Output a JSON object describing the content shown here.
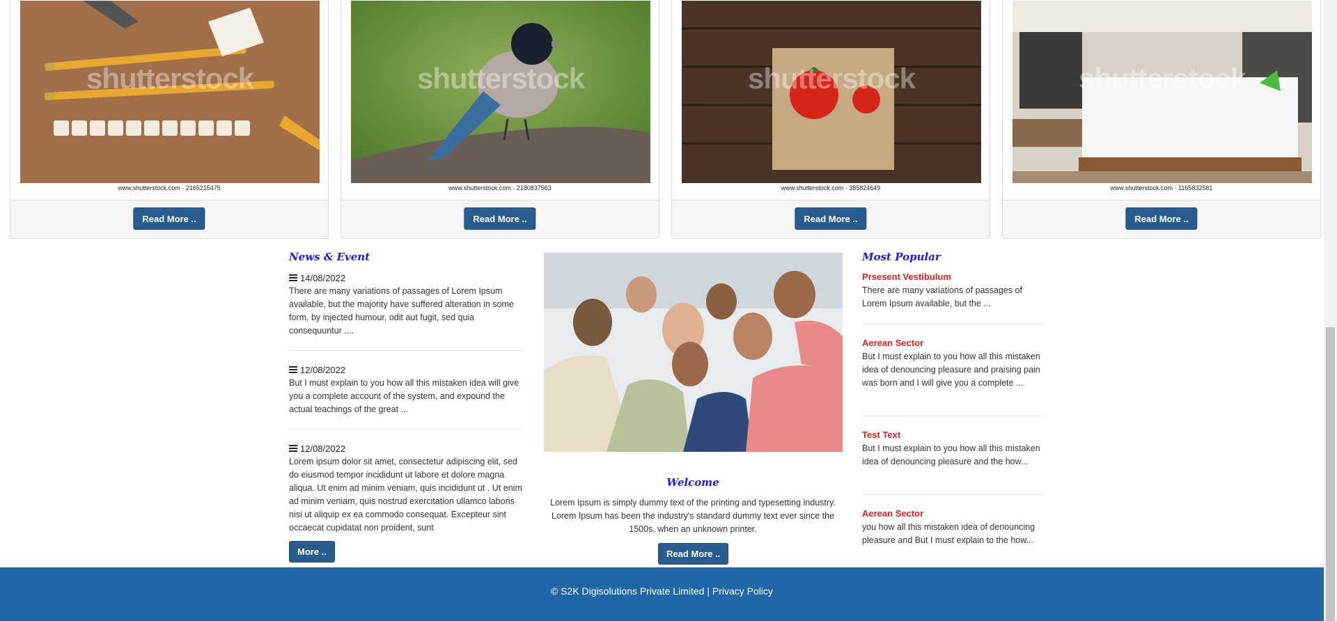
{
  "cards": [
    {
      "image": "pencils-shrinkflation-photo",
      "watermark": "shutterstock",
      "credit": "www.shutterstock.com · 2165215475",
      "button": "Read More .."
    },
    {
      "image": "blue-bird-photo",
      "watermark": "shutterstock",
      "credit": "www.shutterstock.com · 2180837563",
      "button": "Read More .."
    },
    {
      "image": "tomatoes-photo",
      "watermark": "shutterstock",
      "credit": "www.shutterstock.com · 385824649",
      "button": "Read More .."
    },
    {
      "image": "hotel-bedroom-photo",
      "watermark": "shutterstock",
      "credit": "www.shutterstock.com · 1165832581",
      "button": "Read More .."
    }
  ],
  "news": {
    "heading": "News & Event",
    "items": [
      {
        "date": "14/08/2022",
        "text": "There are many variations of passages of Lorem Ipsum available, but the majority have suffered alteration in some form, by injected humour, odit aut fugit, sed quia consequuntur ...."
      },
      {
        "date": "12/08/2022",
        "text": "But I must explain to you how all this mistaken idea will give you a complete account of the system, and expound the actual teachings of the great ..."
      },
      {
        "date": "12/08/2022",
        "text": "Lorem ipsum dolor sit amet, consectetur adipiscing elit, sed do eiusmod tempor incididunt ut labore et dolore magna aliqua. Ut enim ad minim veniam, quis incididunt ut . Ut enim ad minim veniam, quis nostrud exercitation ullamco laboris nisi ut aliquip ex ea commodo consequat. Excepteur sint occaecat cupidatat non proident, sunt"
      }
    ],
    "more_button": "More .."
  },
  "welcome": {
    "image": "group-selfie-photo",
    "title": "Welcome",
    "text": "Lorem Ipsum is simply dummy text of the printing and typesetting industry. Lorem Ipsum has been the industry's standard dummy text ever since the 1500s, when an unknown printer.",
    "button": "Read More .."
  },
  "popular": {
    "heading": "Most Popular",
    "items": [
      {
        "title": "Prsesent Vestibulum",
        "text": "There are many variations of passages of Lorem Ipsum available, but the ..."
      },
      {
        "title": "Aerean Sector",
        "text": "But I must explain to you how all this mistaken idea of denouncing pleasure and praising pain was born and I will give you a complete ..."
      },
      {
        "title": "Test Text",
        "text": "But I must explain to you how all this mistaken idea of denouncing pleasure and the how..."
      },
      {
        "title": "Aerean Sector",
        "text": "you how all this mistaken idea of denouncing pleasure and But I must explain to the how..."
      }
    ]
  },
  "footer": {
    "copyright": "© S2K Digisolutions Private Limited",
    "separator": "|",
    "privacy_link": "Privacy Policy"
  },
  "colors": {
    "button": "#2a5d8f",
    "heading": "#1a1aff",
    "popular_title": "#e61e1e",
    "footer": "#1f67a8"
  }
}
